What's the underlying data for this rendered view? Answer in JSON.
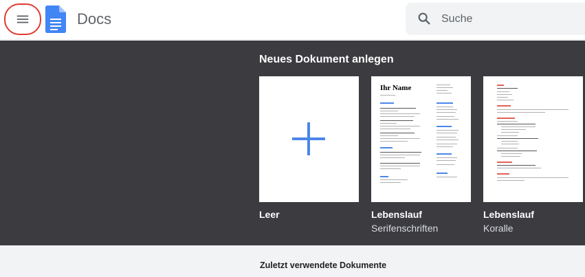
{
  "header": {
    "app_title": "Docs",
    "menu_icon": "hamburger-menu-icon",
    "logo_icon": "docs-logo-icon"
  },
  "search": {
    "placeholder": "Suche",
    "icon": "search-icon"
  },
  "templates": {
    "title": "Neues Dokument anlegen",
    "items": [
      {
        "label": "Leer",
        "sublabel": ""
      },
      {
        "label": "Lebenslauf",
        "sublabel": "Serifenschriften",
        "preview_name": "Ihr Name"
      },
      {
        "label": "Lebenslauf",
        "sublabel": "Koralle"
      }
    ]
  },
  "recent": {
    "title": "Zuletzt verwendete Dokumente"
  },
  "colors": {
    "accent_blue": "#4a86e8",
    "highlight_red": "#e03a2f",
    "templates_bg": "#3b3b40",
    "coral": "#e06155"
  }
}
